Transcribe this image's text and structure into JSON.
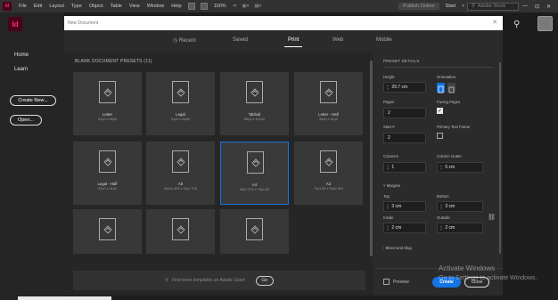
{
  "menubar": {
    "app_badge": "Id",
    "items": [
      "File",
      "Edit",
      "Layout",
      "Type",
      "Object",
      "Table",
      "View",
      "Window",
      "Help"
    ],
    "zoom": "100%",
    "publish": "Publish Online",
    "workspace": "Start",
    "search_placeholder": "Adobe Stock",
    "win_min": "—",
    "win_max": "⊡",
    "win_close": "✕"
  },
  "sidebar": {
    "logo": "Id",
    "home": "Home",
    "learn": "Learn",
    "create_new": "Create New...",
    "open": "Open..."
  },
  "dialog": {
    "title_placeholder": "New Document",
    "close": "✕",
    "tabs": [
      "Recent",
      "Saved",
      "Print",
      "Web",
      "Mobile"
    ],
    "active_tab": "Print",
    "section_title": "BLANK DOCUMENT PRESETS  (11)",
    "presets": [
      {
        "name": "Letter",
        "dim": "51p0 x 66p0"
      },
      {
        "name": "Legal",
        "dim": "51p0 x 84p0"
      },
      {
        "name": "Tabloid",
        "dim": "66p0 x 102p0"
      },
      {
        "name": "Letter - Half",
        "dim": "33p0 x 51p0"
      },
      {
        "name": "Legal - Half",
        "dim": "42p0 x 51p0"
      },
      {
        "name": "A5",
        "dim": "34p11.528 x 49p7.276"
      },
      {
        "name": "A4",
        "dim": "49p7.276 x 70p1.89"
      },
      {
        "name": "A3",
        "dim": "70p1.89 x 99p2.551"
      },
      {
        "name": "",
        "dim": ""
      },
      {
        "name": "",
        "dim": ""
      },
      {
        "name": "",
        "dim": ""
      }
    ],
    "selected_preset": "A4",
    "stock_placeholder": "Find more templates on Adobe Stock",
    "stock_go": "Go"
  },
  "details": {
    "header": "PRESET DETAILS",
    "height_label": "Height",
    "height_value": "29.7 cm",
    "orientation_label": "Orientation",
    "pages_label": "Pages",
    "pages_value": "2",
    "facing_pages_label": "Facing Pages",
    "facing_pages_checked": true,
    "start_label": "Start #",
    "start_value": "2",
    "primary_text_frame_label": "Primary Text Frame",
    "primary_text_frame_checked": false,
    "columns_label": "Columns",
    "columns_value": "1",
    "gutter_label": "Column Gutter",
    "gutter_value": "5 cm",
    "margins_label": "Margins",
    "top_label": "Top",
    "top_value": "3 cm",
    "bottom_label": "Bottom",
    "bottom_value": "3 cm",
    "inside_label": "Inside",
    "inside_value": "2 cm",
    "outside_label": "Outside",
    "outside_value": "2 cm",
    "bleed_label": "Bleed and Slug",
    "preview_label": "Preview",
    "create_label": "Create",
    "close_label": "Close"
  },
  "watermark": {
    "line1": "Activate Windows",
    "line2": "Go to Settings to activate Windows."
  }
}
